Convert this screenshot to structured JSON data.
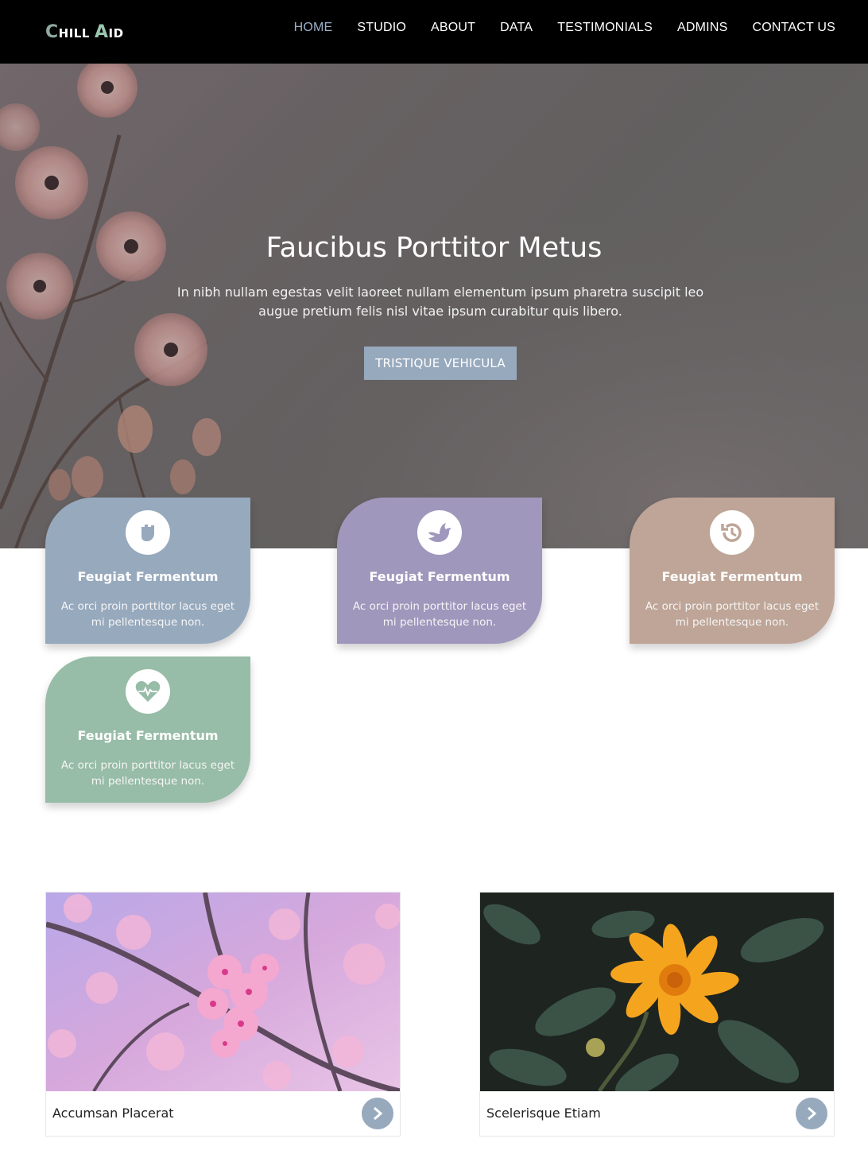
{
  "nav": {
    "logo": {
      "part1_big": "C",
      "part1_small": "HILL",
      "part2_big": "A",
      "part2_small": "ID"
    },
    "items": [
      {
        "label": "HOME",
        "active": true
      },
      {
        "label": "STUDIO"
      },
      {
        "label": "ABOUT"
      },
      {
        "label": "DATA"
      },
      {
        "label": "TESTIMONIALS"
      },
      {
        "label": "ADMINS"
      },
      {
        "label": "CONTACT US"
      }
    ]
  },
  "hero": {
    "title": "Faucibus Porttitor Metus",
    "text": "In nibh nullam egestas velit laoreet nullam elementum ipsum pharetra suscipit leo augue pretium felis nisl vitae ipsum curabitur quis libero.",
    "button": "TRISTIQUE VEHICULA"
  },
  "features": [
    {
      "icon": "hand-fist-icon",
      "title": "Feugiat Fermentum",
      "text": "Ac orci proin porttitor lacus eget mi pellentesque non.",
      "color": "#97a9bd"
    },
    {
      "icon": "dove-icon",
      "title": "Feugiat Fermentum",
      "text": "Ac orci proin porttitor lacus eget mi pellentesque non.",
      "color": "#a097bc"
    },
    {
      "icon": "history-icon",
      "title": "Feugiat Fermentum",
      "text": "Ac orci proin porttitor lacus eget mi pellentesque non.",
      "color": "#bea597"
    },
    {
      "icon": "heart-pulse-icon",
      "title": "Feugiat Fermentum",
      "text": "Ac orci proin porttitor lacus eget mi pellentesque non.",
      "color": "#97bca7"
    }
  ],
  "gallery": [
    {
      "caption": "Accumsan Placerat",
      "arrow_icon": "chevron-right-icon"
    },
    {
      "caption": "Scelerisque Etiam",
      "arrow_icon": "chevron-right-icon"
    }
  ],
  "colors": {
    "accent": "#97a9bd",
    "nav_bg": "#000000",
    "active_link": "#9bb0c8"
  }
}
